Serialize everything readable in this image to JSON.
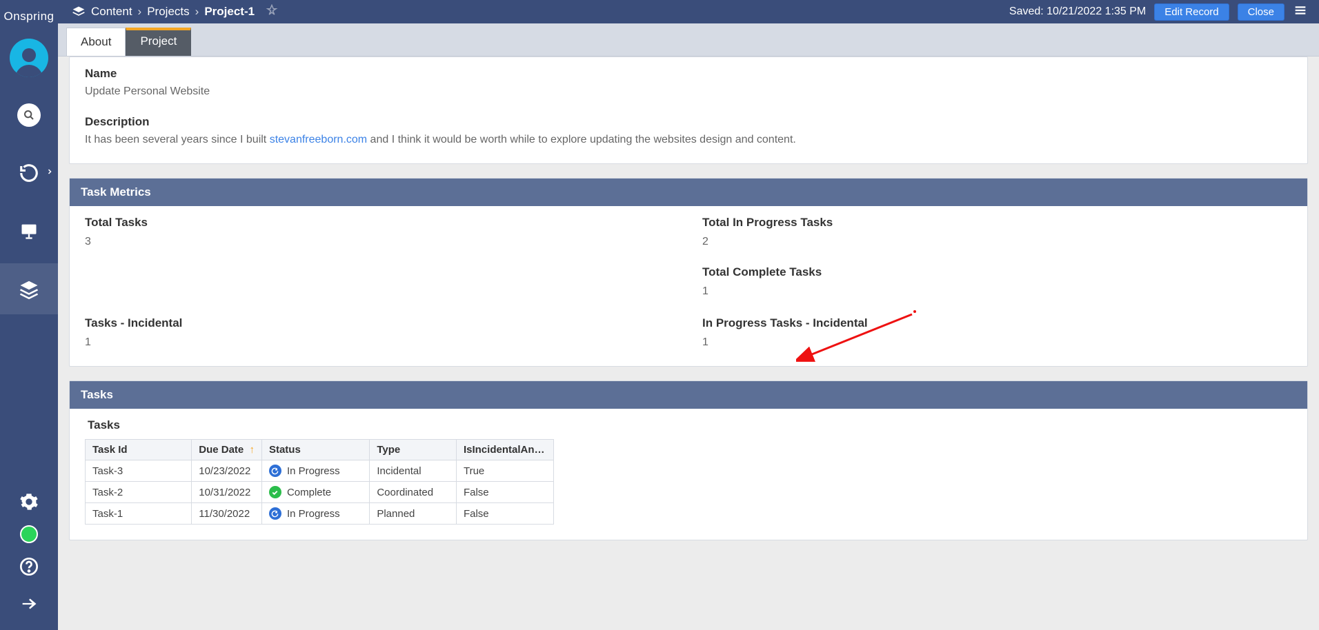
{
  "brand": "Onspring",
  "breadcrumb": {
    "icon": "layers-icon",
    "items": [
      "Content",
      "Projects"
    ],
    "current": "Project-1"
  },
  "topbar": {
    "saved": "Saved: 10/21/2022 1:35 PM",
    "edit_label": "Edit Record",
    "close_label": "Close"
  },
  "tabs": [
    {
      "label": "About",
      "active": false
    },
    {
      "label": "Project",
      "active": true
    }
  ],
  "project": {
    "name_label": "Name",
    "name_value": "Update Personal Website",
    "description_label": "Description",
    "description_pre": "It has been several years since I built ",
    "description_link": "stevanfreeborn.com",
    "description_post": " and I think it would be worth while to explore updating the websites design and content."
  },
  "metrics": {
    "header": "Task Metrics",
    "m1": {
      "label": "Total Tasks",
      "value": "3"
    },
    "m2": {
      "label": "Total In Progress Tasks",
      "value": "2"
    },
    "m3": {
      "label": "Total Complete Tasks",
      "value": "1"
    },
    "m4": {
      "label": "Tasks - Incidental",
      "value": "1"
    },
    "m5": {
      "label": "In Progress Tasks - Incidental",
      "value": "1"
    }
  },
  "tasks": {
    "header": "Tasks",
    "subheader": "Tasks",
    "columns": {
      "c0": "Task Id",
      "c1": "Due Date",
      "c2": "Status",
      "c3": "Type",
      "c4": "IsIncidentalAnd…"
    },
    "rows": [
      {
        "id": "Task-3",
        "due": "10/23/2022",
        "status": "In Progress",
        "status_kind": "progress",
        "type": "Incidental",
        "flag": "True"
      },
      {
        "id": "Task-2",
        "due": "10/31/2022",
        "status": "Complete",
        "status_kind": "complete",
        "type": "Coordinated",
        "flag": "False"
      },
      {
        "id": "Task-1",
        "due": "11/30/2022",
        "status": "In Progress",
        "status_kind": "progress",
        "type": "Planned",
        "flag": "False"
      }
    ]
  }
}
